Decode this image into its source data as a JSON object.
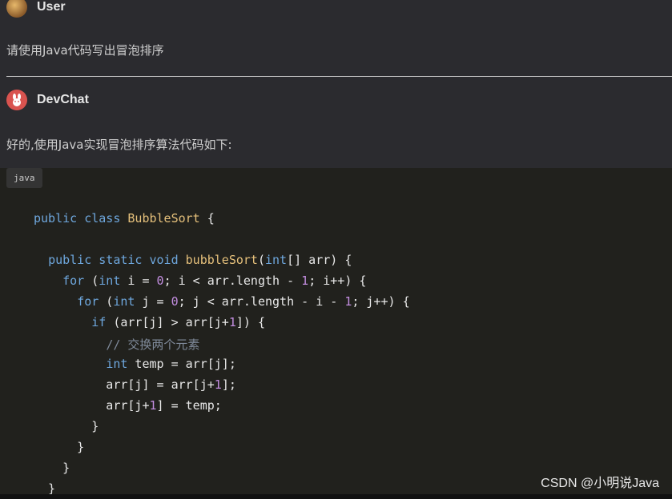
{
  "conversation": {
    "user": {
      "author": "User",
      "message": "请使用Java代码写出冒泡排序"
    },
    "bot": {
      "author": "DevChat",
      "intro": "好的,使用Java实现冒泡排序算法代码如下:",
      "code_language": "java",
      "code_lines": [
        "public class BubbleSort {",
        "",
        "  public static void bubbleSort(int[] arr) {",
        "    for (int i = 0; i < arr.length - 1; i++) {",
        "      for (int j = 0; j < arr.length - i - 1; j++) {",
        "        if (arr[j] > arr[j+1]) {",
        "          // 交换两个元素",
        "          int temp = arr[j];",
        "          arr[j] = arr[j+1];",
        "          arr[j+1] = temp;",
        "        }",
        "      }",
        "    }",
        "  }"
      ]
    }
  },
  "watermark": "CSDN @小明说Java",
  "icons": {
    "user_avatar": "user-avatar-icon",
    "bot_avatar": "devchat-logo-icon"
  },
  "colors": {
    "background": "#2b2b2f",
    "code_background": "#21211d",
    "keyword": "#6ea7dd",
    "class_name": "#e5c07b",
    "number": "#c38ee0",
    "comment": "#7f8a9a"
  }
}
